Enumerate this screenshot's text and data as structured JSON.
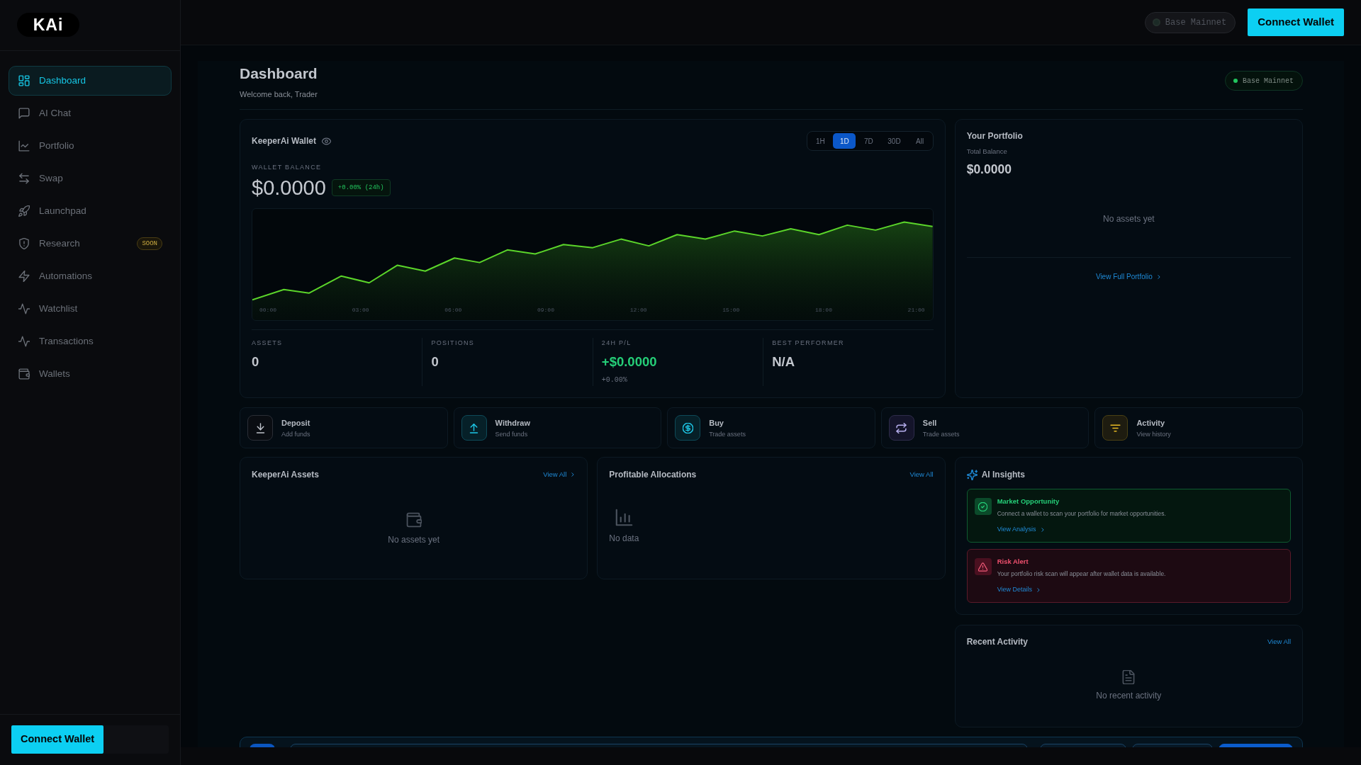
{
  "sidebar": {
    "logo": "KAi",
    "items": [
      {
        "label": "Dashboard",
        "selected": true
      },
      {
        "label": "AI Chat",
        "selected": false
      },
      {
        "label": "Portfolio",
        "selected": false
      },
      {
        "label": "Swap",
        "selected": false
      },
      {
        "label": "Launchpad",
        "selected": false
      },
      {
        "label": "Research",
        "selected": false,
        "badge": "SOON"
      },
      {
        "label": "Automations",
        "selected": false
      },
      {
        "label": "Watchlist",
        "selected": false
      },
      {
        "label": "Transactions",
        "selected": false
      },
      {
        "label": "Wallets",
        "selected": false
      }
    ],
    "connect_button": "Connect Wallet"
  },
  "topbar": {
    "network": {
      "label": "Base Mainnet",
      "connected": false
    },
    "connect_button": "Connect Wallet"
  },
  "header": {
    "title": "Dashboard",
    "subtitle": "Welcome back, Trader",
    "network": {
      "label": "Base Mainnet",
      "connected": true
    }
  },
  "wallet_card": {
    "title": "KeeperAi Wallet",
    "ranges": [
      {
        "label": "1H",
        "selected": false
      },
      {
        "label": "1D",
        "selected": true
      },
      {
        "label": "7D",
        "selected": false
      },
      {
        "label": "30D",
        "selected": false
      },
      {
        "label": "All",
        "selected": false
      }
    ],
    "balance_label": "WALLET BALANCE",
    "balance": "$0.0000",
    "change": "+0.00% (24h)",
    "time_labels": [
      "00:00",
      "03:00",
      "06:00",
      "09:00",
      "12:00",
      "15:00",
      "18:00",
      "21:00"
    ],
    "stats": [
      {
        "kind": "plain",
        "label": "ASSETS",
        "value": "0"
      },
      {
        "kind": "plain",
        "label": "POSITIONS",
        "value": "0"
      },
      {
        "kind": "gain",
        "label": "24H P/L",
        "value": "+$0.0000",
        "sub": "+0.00%"
      },
      {
        "kind": "plain",
        "label": "BEST PERFORMER",
        "value": "N/A"
      }
    ]
  },
  "portfolio_card": {
    "title": "Your Portfolio",
    "balance_label": "Total Balance",
    "balance": "$0.0000",
    "empty_text": "No assets yet",
    "link": "View Full Portfolio"
  },
  "actions": [
    {
      "kind": "deposit",
      "title": "Deposit",
      "subtitle": "Add funds"
    },
    {
      "kind": "withdraw",
      "title": "Withdraw",
      "subtitle": "Send funds"
    },
    {
      "kind": "buy",
      "title": "Buy",
      "subtitle": "Trade assets"
    },
    {
      "kind": "sell",
      "title": "Sell",
      "subtitle": "Trade assets"
    },
    {
      "kind": "activity",
      "title": "Activity",
      "subtitle": "View history"
    }
  ],
  "assets_card": {
    "title": "KeeperAi Assets",
    "link": "View All",
    "empty_text": "No assets yet"
  },
  "allocations_card": {
    "title": "Profitable Allocations",
    "link": "View All",
    "empty_text": "No data"
  },
  "insights_card": {
    "title": "AI Insights",
    "items": [
      {
        "kind": "opportunity",
        "title": "Market Opportunity",
        "text": "Connect a wallet to scan your portfolio for market opportunities.",
        "link": "View Analysis"
      },
      {
        "kind": "risk",
        "title": "Risk Alert",
        "text": "Your portfolio risk scan will appear after wallet data is available.",
        "link": "View Details"
      }
    ]
  },
  "activity_card": {
    "title": "Recent Activity",
    "link": "View All",
    "empty_text": "No recent activity"
  }
}
